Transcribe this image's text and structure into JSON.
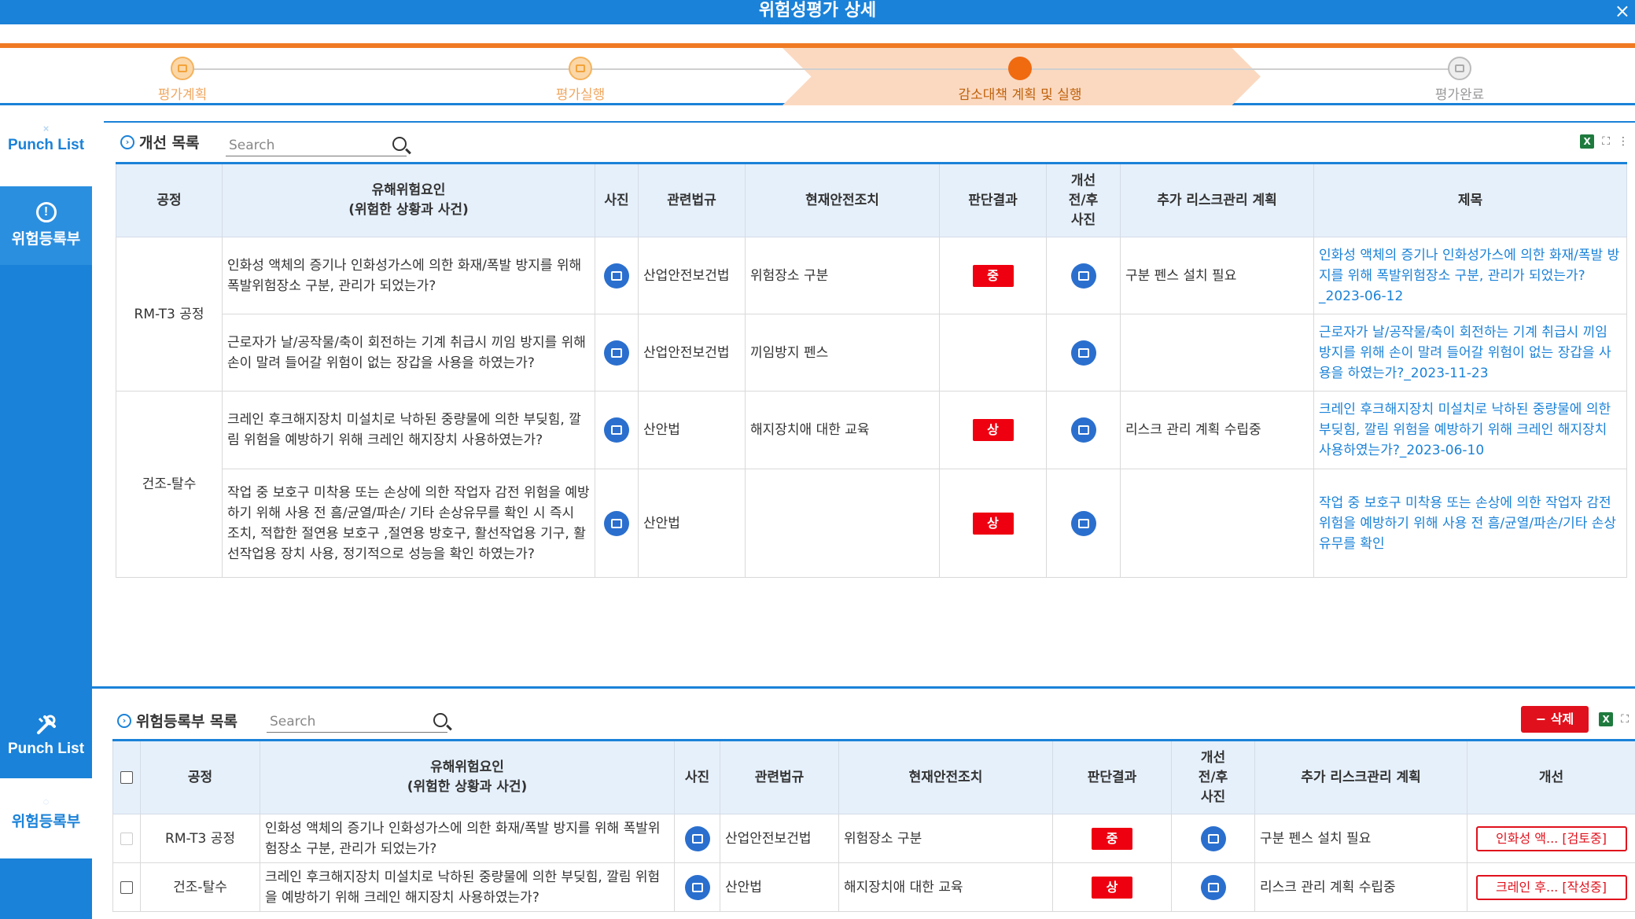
{
  "window": {
    "title": "위험성평가 상세",
    "close_glyph": "×"
  },
  "colors": {
    "primary": "#1a82d8",
    "accent": "#f07a24",
    "danger": "#e0111c"
  },
  "stepper": {
    "steps": [
      {
        "label": "평가계획",
        "state": "done"
      },
      {
        "label": "평가실행",
        "state": "done"
      },
      {
        "label": "감소대책 계획 및 실행",
        "state": "current"
      },
      {
        "label": "평가완료",
        "state": "todo"
      }
    ]
  },
  "sidebar": {
    "top_faint": "×",
    "item1": "Punch List",
    "item2": "위험등록부",
    "item3": "Punch List",
    "item4": "위험등록부",
    "item4_faint": "◌"
  },
  "improve_panel": {
    "title": "개선 목록",
    "search_placeholder": "Search",
    "icons": [
      "excel-icon",
      "fullscreen-icon",
      "more-icon"
    ],
    "more_glyph": "⋮",
    "fullscreen_glyph": "⛶",
    "columns": [
      "공정",
      "유해위험요인\n(위험한 상황과 사건)",
      "사진",
      "관련법규",
      "현재안전조치",
      "판단결과",
      "개선\n전/후\n사진",
      "추가 리스크관리 계획",
      "제목"
    ],
    "groups": [
      {
        "process": "RM-T3 공정",
        "rows": [
          {
            "hazard": "인화성 액체의 증기나 인화성가스에 의한 화재/폭발 방지를 위해 폭발위험장소 구분, 관리가 되었는가?",
            "law": "산업안전보건법",
            "measure": "위험장소 구분",
            "grade": "중",
            "plan": "구분 펜스 설치 필요",
            "title": "인화성 액체의 증기나 인화성가스에 의한 화재/폭발 방지를 위해 폭발위험장소 구분, 관리가 되었는가?_2023-06-12"
          },
          {
            "hazard": "근로자가 날/공작물/축이 회전하는 기계 취급시 끼임 방지를 위해 손이 말려 들어갈 위험이 없는 장갑을 사용을 하였는가?",
            "law": "산업안전보건법",
            "measure": "끼임방지 펜스",
            "grade": "",
            "plan": "",
            "title": "근로자가 날/공작물/축이 회전하는 기계 취급시 끼임 방지를 위해 손이 말려 들어갈 위험이 없는 장갑을 사용을 하였는가?_2023-11-23"
          }
        ]
      },
      {
        "process": "건조-탈수",
        "rows": [
          {
            "hazard": "크레인 후크해지장치 미설치로 낙하된 중량물에 의한 부딪힘, 깔림 위험을 예방하기 위해 크레인 해지장치 사용하였는가?",
            "law": "산안법",
            "measure": "해지장치애 대한 교육",
            "grade": "상",
            "plan": "리스크 관리 계획 수립중",
            "title": "크레인 후크해지장치 미설치로 낙하된 중량물에 의한 부딪힘, 깔림 위험을 예방하기 위해 크레인 해지장치 사용하였는가?_2023-06-10"
          },
          {
            "hazard": "작업 중 보호구 미착용 또는 손상에 의한 작업자 감전 위험을 예방하기 위해 사용 전 흠/균열/파손/ 기타 손상유무를 확인 시 즉시 조치, 적합한 절연용 보호구 ,절연용 방호구, 활선작업용 기구, 활선작업용 장치 사용, 정기적으로 성능을 확인 하였는가?",
            "law": "산안법",
            "measure": "",
            "grade": "상",
            "plan": "",
            "title": "작업 중 보호구 미착용 또는 손상에 의한 작업자 감전 위험을 예방하기 위해 사용 전 흠/균열/파손/기타 손상유무를 확인"
          }
        ]
      }
    ]
  },
  "register_panel": {
    "title": "위험등록부 목록",
    "search_placeholder": "Search",
    "delete_label": "− 삭제",
    "columns": [
      "공정",
      "유해위험요인\n(위험한 상황과 사건)",
      "사진",
      "관련법규",
      "현재안전조치",
      "판단결과",
      "개선\n전/후\n사진",
      "추가 리스크관리 계획",
      "개선"
    ],
    "rows": [
      {
        "process": "RM-T3 공정",
        "hazard": "인화성 액체의 증기나 인화성가스에 의한 화재/폭발 방지를 위해 폭발위험장소 구분, 관리가 되었는가?",
        "law": "산업안전보건법",
        "measure": "위험장소 구분",
        "grade": "중",
        "plan": "구분 펜스 설치 필요",
        "improve": "인화성 액... [검토중]",
        "checkbox_disabled": true
      },
      {
        "process": "건조-탈수",
        "hazard": "크레인 후크해지장치 미설치로 낙하된 중량물에 의한 부딪힘, 깔림 위험을 예방하기 위해 크레인 해지장치 사용하였는가?",
        "law": "산안법",
        "measure": "해지장치애 대한 교육",
        "grade": "상",
        "plan": "리스크 관리 계획 수립중",
        "improve": "크레인 후... [작성중]",
        "checkbox_disabled": false
      }
    ]
  }
}
